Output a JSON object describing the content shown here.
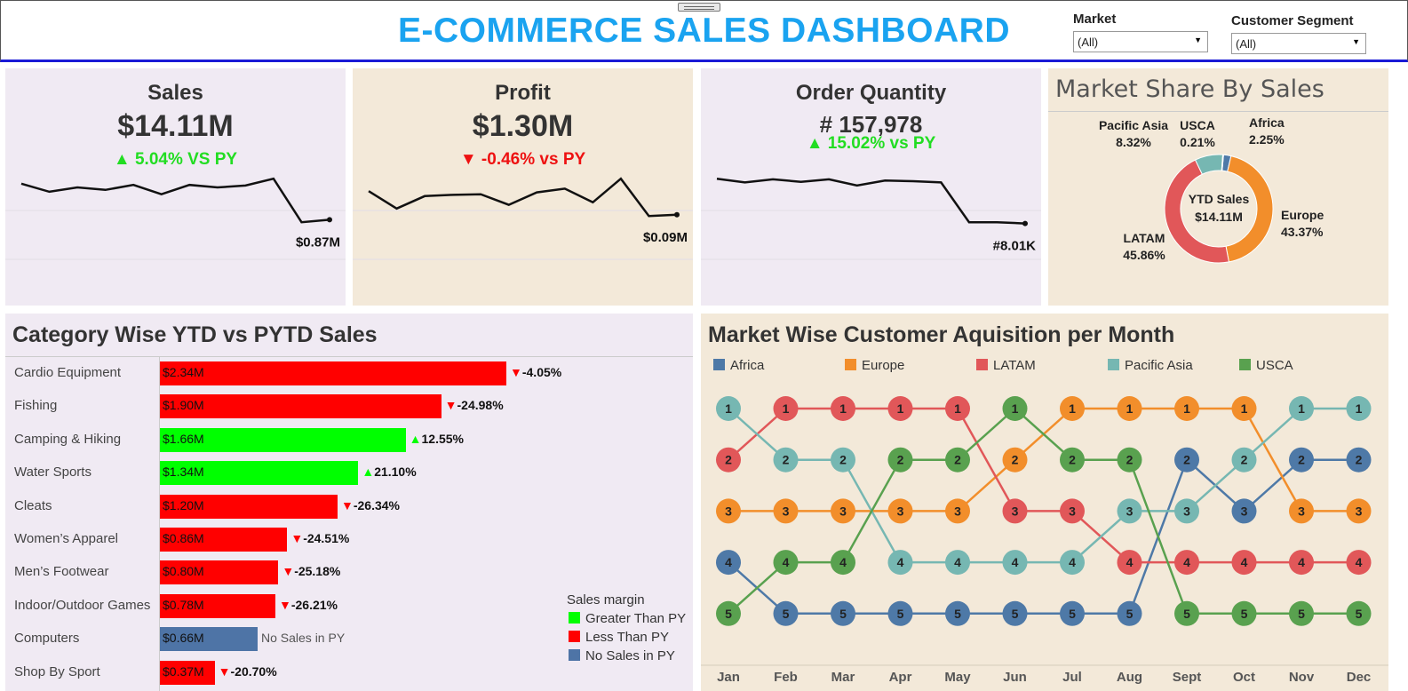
{
  "header": {
    "title": "E-COMMERCE SALES DASHBOARD",
    "filters": [
      {
        "label": "Market",
        "value": "(All)"
      },
      {
        "label": "Customer Segment",
        "value": "(All)"
      }
    ]
  },
  "kpis": [
    {
      "title": "Sales",
      "value": "$14.11M",
      "delta": "5.04% VS PY",
      "direction": "up",
      "last_label": "$0.87M",
      "trend": [
        0.86,
        0.73,
        0.8,
        0.76,
        0.84,
        0.69,
        0.84,
        0.8,
        0.83,
        0.94,
        0.24,
        0.28
      ]
    },
    {
      "title": "Profit",
      "value": "$1.30M",
      "delta": "-0.46% vs PY",
      "direction": "down",
      "last_label": "$0.09M",
      "trend": [
        0.74,
        0.46,
        0.66,
        0.68,
        0.69,
        0.52,
        0.72,
        0.78,
        0.56,
        0.94,
        0.34,
        0.36
      ]
    },
    {
      "title": "Order Quantity",
      "value": "# 157,978",
      "delta": "15.02% vs PY",
      "direction": "up",
      "last_label": "#8.01K",
      "trend": [
        0.94,
        0.88,
        0.93,
        0.89,
        0.93,
        0.83,
        0.91,
        0.9,
        0.88,
        0.24,
        0.24,
        0.22
      ]
    }
  ],
  "colors": {
    "up": "#00ff00",
    "down": "#ff0000",
    "none": "#4e74a6",
    "title": "#1aa3f0",
    "Africa": "#4e79a7",
    "Europe": "#f28e2b",
    "LATAM": "#e15759",
    "Pacific Asia": "#76b7b2",
    "USCA": "#59a14f"
  },
  "market_share": {
    "title": "Market Share By Sales",
    "center_label": "YTD Sales",
    "center_value": "$14.11M"
  },
  "category": {
    "title": "Category Wise YTD vs PYTD Sales",
    "legend_title": "Sales margin",
    "legend": [
      {
        "label": "Greater Than PY",
        "key": "up"
      },
      {
        "label": "Less Than PY",
        "key": "down"
      },
      {
        "label": "No Sales in PY",
        "key": "none"
      }
    ]
  },
  "acquisition": {
    "title": "Market Wise Customer Aquisition per Month"
  },
  "chart_data": [
    {
      "type": "pie",
      "title": "Market Share By Sales",
      "categories": [
        "Europe",
        "LATAM",
        "Pacific Asia",
        "USCA",
        "Africa"
      ],
      "values": [
        43.37,
        45.86,
        8.32,
        0.21,
        2.25
      ],
      "labels": [
        "43.37%",
        "45.86%",
        "8.32%",
        "0.21%",
        "2.25%"
      ]
    },
    {
      "type": "bar",
      "title": "Category Wise YTD vs PYTD Sales",
      "categories": [
        "Cardio Equipment",
        "Fishing",
        "Camping & Hiking",
        "Water Sports",
        "Cleats",
        "Women’s Apparel",
        "Men’s Footwear",
        "Indoor/Outdoor Games",
        "Computers",
        "Shop By Sport"
      ],
      "values": [
        2.34,
        1.9,
        1.66,
        1.34,
        1.2,
        0.86,
        0.8,
        0.78,
        0.66,
        0.37
      ],
      "value_labels": [
        "$2.34M",
        "$1.90M",
        "$1.66M",
        "$1.34M",
        "$1.20M",
        "$0.86M",
        "$0.80M",
        "$0.78M",
        "$0.66M",
        "$0.37M"
      ],
      "change_labels": [
        "-4.05%",
        "-24.98%",
        "12.55%",
        "21.10%",
        "-26.34%",
        "-24.51%",
        "-25.18%",
        "-26.21%",
        "No Sales in PY",
        "-20.70%"
      ],
      "status": [
        "down",
        "down",
        "up",
        "up",
        "down",
        "down",
        "down",
        "down",
        "none",
        "down"
      ]
    },
    {
      "type": "line",
      "title": "Market Wise Customer Aquisition per Month",
      "x": [
        "Jan",
        "Feb",
        "Mar",
        "Apr",
        "May",
        "Jun",
        "Jul",
        "Aug",
        "Sept",
        "Oct",
        "Nov",
        "Dec"
      ],
      "series": [
        {
          "name": "Africa",
          "values": [
            4,
            5,
            5,
            5,
            5,
            5,
            5,
            5,
            2,
            3,
            2,
            2
          ]
        },
        {
          "name": "Europe",
          "values": [
            3,
            3,
            3,
            3,
            3,
            2,
            1,
            1,
            1,
            1,
            3,
            3
          ]
        },
        {
          "name": "LATAM",
          "values": [
            2,
            1,
            1,
            1,
            1,
            3,
            3,
            4,
            4,
            4,
            4,
            4
          ]
        },
        {
          "name": "Pacific Asia",
          "values": [
            1,
            2,
            2,
            4,
            4,
            4,
            4,
            3,
            3,
            2,
            1,
            1
          ]
        },
        {
          "name": "USCA",
          "values": [
            5,
            4,
            4,
            2,
            2,
            1,
            2,
            2,
            5,
            5,
            5,
            5
          ]
        }
      ],
      "ylim": [
        1,
        5
      ]
    }
  ]
}
